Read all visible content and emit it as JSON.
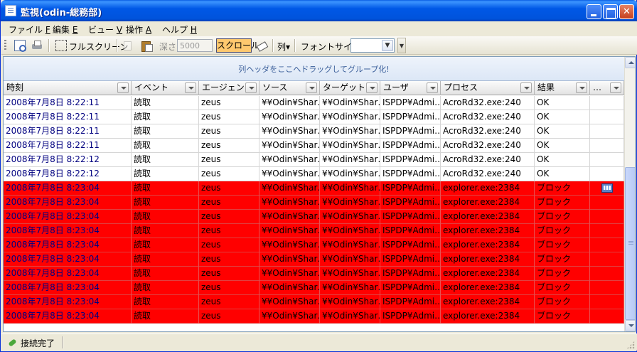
{
  "window": {
    "title": "監視(odin-総務部)"
  },
  "menu": [
    {
      "label": "ファイル",
      "key": "F"
    },
    {
      "label": "編集",
      "key": "E"
    },
    {
      "label": "ビュー",
      "key": "V"
    },
    {
      "label": "操作",
      "key": "A"
    },
    {
      "label": "ヘルプ",
      "key": "H"
    }
  ],
  "toolbar": {
    "fullscreen_label": "フルスクリーン",
    "depth_label": "深さ",
    "depth_value": "5000",
    "scroll_label": "スクロール",
    "columns_label": "列▾",
    "fontsize_label": "フォントサイズ",
    "fontsize_value": ""
  },
  "grid": {
    "group_hint": "列ヘッダをここへドラッグしてグループ化!",
    "columns": [
      "時刻",
      "イベント",
      "エージェント",
      "ソース",
      "ターゲット",
      "ユーザ",
      "プロセス",
      "結果",
      "…"
    ],
    "rows": [
      {
        "time": "2008年7月8日  8:22:11",
        "event": "読取",
        "agent": "zeus",
        "source": "¥¥Odin¥Shar…",
        "target": "¥¥Odin¥Shar…",
        "user": "ISPDP¥Admi…",
        "process": "AcroRd32.exe:240",
        "result": "OK",
        "alert": false,
        "flag": false
      },
      {
        "time": "2008年7月8日  8:22:11",
        "event": "読取",
        "agent": "zeus",
        "source": "¥¥Odin¥Shar…",
        "target": "¥¥Odin¥Shar…",
        "user": "ISPDP¥Admi…",
        "process": "AcroRd32.exe:240",
        "result": "OK",
        "alert": false,
        "flag": false
      },
      {
        "time": "2008年7月8日  8:22:11",
        "event": "読取",
        "agent": "zeus",
        "source": "¥¥Odin¥Shar…",
        "target": "¥¥Odin¥Shar…",
        "user": "ISPDP¥Admi…",
        "process": "AcroRd32.exe:240",
        "result": "OK",
        "alert": false,
        "flag": false
      },
      {
        "time": "2008年7月8日  8:22:11",
        "event": "読取",
        "agent": "zeus",
        "source": "¥¥Odin¥Shar…",
        "target": "¥¥Odin¥Shar…",
        "user": "ISPDP¥Admi…",
        "process": "AcroRd32.exe:240",
        "result": "OK",
        "alert": false,
        "flag": false
      },
      {
        "time": "2008年7月8日  8:22:12",
        "event": "読取",
        "agent": "zeus",
        "source": "¥¥Odin¥Shar…",
        "target": "¥¥Odin¥Shar…",
        "user": "ISPDP¥Admi…",
        "process": "AcroRd32.exe:240",
        "result": "OK",
        "alert": false,
        "flag": false
      },
      {
        "time": "2008年7月8日  8:22:12",
        "event": "読取",
        "agent": "zeus",
        "source": "¥¥Odin¥Shar…",
        "target": "¥¥Odin¥Shar…",
        "user": "ISPDP¥Admi…",
        "process": "AcroRd32.exe:240",
        "result": "OK",
        "alert": false,
        "flag": false
      },
      {
        "time": "2008年7月8日  8:23:04",
        "event": "読取",
        "agent": "zeus",
        "source": "¥¥Odin¥Shar…",
        "target": "¥¥Odin¥Shar…",
        "user": "ISPDP¥Admi…",
        "process": "explorer.exe:2384",
        "result": "ブロック",
        "alert": true,
        "flag": true
      },
      {
        "time": "2008年7月8日  8:23:04",
        "event": "読取",
        "agent": "zeus",
        "source": "¥¥Odin¥Shar…",
        "target": "¥¥Odin¥Shar…",
        "user": "ISPDP¥Admi…",
        "process": "explorer.exe:2384",
        "result": "ブロック",
        "alert": true,
        "flag": false
      },
      {
        "time": "2008年7月8日  8:23:04",
        "event": "読取",
        "agent": "zeus",
        "source": "¥¥Odin¥Shar…",
        "target": "¥¥Odin¥Shar…",
        "user": "ISPDP¥Admi…",
        "process": "explorer.exe:2384",
        "result": "ブロック",
        "alert": true,
        "flag": false
      },
      {
        "time": "2008年7月8日  8:23:04",
        "event": "読取",
        "agent": "zeus",
        "source": "¥¥Odin¥Shar…",
        "target": "¥¥Odin¥Shar…",
        "user": "ISPDP¥Admi…",
        "process": "explorer.exe:2384",
        "result": "ブロック",
        "alert": true,
        "flag": false
      },
      {
        "time": "2008年7月8日  8:23:04",
        "event": "読取",
        "agent": "zeus",
        "source": "¥¥Odin¥Shar…",
        "target": "¥¥Odin¥Shar…",
        "user": "ISPDP¥Admi…",
        "process": "explorer.exe:2384",
        "result": "ブロック",
        "alert": true,
        "flag": false
      },
      {
        "time": "2008年7月8日  8:23:04",
        "event": "読取",
        "agent": "zeus",
        "source": "¥¥Odin¥Shar…",
        "target": "¥¥Odin¥Shar…",
        "user": "ISPDP¥Admi…",
        "process": "explorer.exe:2384",
        "result": "ブロック",
        "alert": true,
        "flag": false
      },
      {
        "time": "2008年7月8日  8:23:04",
        "event": "読取",
        "agent": "zeus",
        "source": "¥¥Odin¥Shar…",
        "target": "¥¥Odin¥Shar…",
        "user": "ISPDP¥Admi…",
        "process": "explorer.exe:2384",
        "result": "ブロック",
        "alert": true,
        "flag": false
      },
      {
        "time": "2008年7月8日  8:23:04",
        "event": "読取",
        "agent": "zeus",
        "source": "¥¥Odin¥Shar…",
        "target": "¥¥Odin¥Shar…",
        "user": "ISPDP¥Admi…",
        "process": "explorer.exe:2384",
        "result": "ブロック",
        "alert": true,
        "flag": false
      },
      {
        "time": "2008年7月8日  8:23:04",
        "event": "読取",
        "agent": "zeus",
        "source": "¥¥Odin¥Shar…",
        "target": "¥¥Odin¥Shar…",
        "user": "ISPDP¥Admi…",
        "process": "explorer.exe:2384",
        "result": "ブロック",
        "alert": true,
        "flag": false
      },
      {
        "time": "2008年7月8日  8:23:04",
        "event": "読取",
        "agent": "zeus",
        "source": "¥¥Odin¥Shar…",
        "target": "¥¥Odin¥Shar…",
        "user": "ISPDP¥Admi…",
        "process": "explorer.exe:2384",
        "result": "ブロック",
        "alert": true,
        "flag": false
      }
    ]
  },
  "status": {
    "text": "接続完了"
  },
  "colors": {
    "alert_row": "#ff0000",
    "title_bar": "#0058e6",
    "time_text": "#000080",
    "scroll_toggle": "#ffc86e"
  }
}
